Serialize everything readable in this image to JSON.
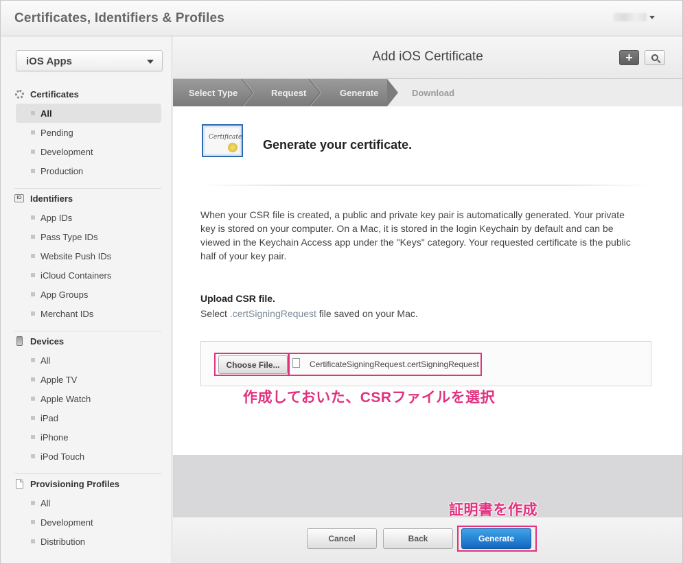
{
  "app": {
    "title": "Certificates, Identifiers & Profiles"
  },
  "sidebar": {
    "platform_select": "iOS Apps",
    "sections": [
      {
        "title": "Certificates",
        "icon": "certificate-gear-icon",
        "items": [
          "All",
          "Pending",
          "Development",
          "Production"
        ],
        "selected": "All"
      },
      {
        "title": "Identifiers",
        "icon": "id-badge-icon",
        "items": [
          "App IDs",
          "Pass Type IDs",
          "Website Push IDs",
          "iCloud Containers",
          "App Groups",
          "Merchant IDs"
        ]
      },
      {
        "title": "Devices",
        "icon": "device-icon",
        "items": [
          "All",
          "Apple TV",
          "Apple Watch",
          "iPad",
          "iPhone",
          "iPod Touch"
        ]
      },
      {
        "title": "Provisioning Profiles",
        "icon": "document-icon",
        "items": [
          "All",
          "Development",
          "Distribution"
        ]
      }
    ]
  },
  "main": {
    "title": "Add iOS Certificate",
    "add_button": "+",
    "steps": [
      "Select Type",
      "Request",
      "Generate",
      "Download"
    ],
    "heading": "Generate your certificate.",
    "cert_icon_text": "Certificate",
    "description": "When your CSR file is created, a public and private key pair is automatically generated. Your private key is stored on your computer. On a Mac, it is stored in the login Keychain by default and can be viewed in the Keychain Access app under the \"Keys\" category. Your requested certificate is the public half of your key pair.",
    "upload_title": "Upload CSR file.",
    "upload_sub_prefix": "Select ",
    "upload_sub_ext": ".certSigningRequest",
    "upload_sub_suffix": " file saved on your Mac.",
    "choose_button": "Choose File...",
    "file_name": "CertificateSigningRequest.certSigningRequest",
    "annotation_file": "作成しておいた、CSRファイルを選択",
    "annotation_generate": "証明書を作成"
  },
  "footer": {
    "cancel": "Cancel",
    "back": "Back",
    "generate": "Generate"
  },
  "colors": {
    "annotation": "#e2317f",
    "primary_button": "#1f7fd6"
  }
}
